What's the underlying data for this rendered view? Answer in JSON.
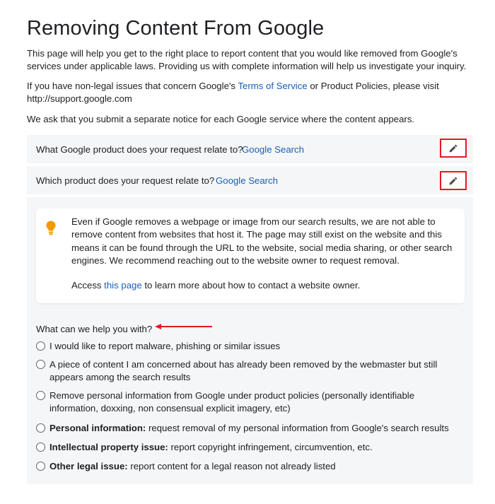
{
  "page": {
    "title": "Removing Content From Google",
    "intro": "This page will help you get to the right place to report content that you would like removed from Google's services under applicable laws. Providing us with complete information will help us investigate your inquiry.",
    "nonlegal_pre": "If you have non-legal issues that concern Google's ",
    "terms_link": "Terms of Service",
    "nonlegal_post": " or Product Policies, please visit http://support.google.com",
    "separate_notice": "We ask that you submit a separate notice for each Google service where the content appears."
  },
  "questions": [
    {
      "question": "What Google product does your request relate to?",
      "answer": "Google Search",
      "edit_icon": "pencil-icon"
    },
    {
      "question": "Which product does your request relate to?",
      "answer": "Google Search",
      "edit_icon": "pencil-icon"
    }
  ],
  "notice": {
    "icon": "lightbulb-icon",
    "text": "Even if Google removes a webpage or image from our search results, we are not able to remove content from websites that host it. The page may still exist on the website and this means it can be found through the URL to the website, social media sharing, or other search engines. We recommend reaching out to the website owner to request removal.",
    "access_pre": "Access ",
    "access_link": "this page",
    "access_post": " to learn more about how to contact a website owner."
  },
  "help": {
    "question": "What can we help you with?",
    "options": [
      {
        "bold": "",
        "text": "I would like to report malware, phishing or similar issues"
      },
      {
        "bold": "",
        "text": "A piece of content I am concerned about has already been removed by the webmaster but still appears among the search results"
      },
      {
        "bold": "",
        "text": "Remove personal information from Google under product policies (personally identifiable information, doxxing, non consensual explicit imagery, etc)"
      },
      {
        "bold": "Personal information:",
        "text": " request removal of my personal information from Google's search results"
      },
      {
        "bold": "Intellectual property issue:",
        "text": " report copyright infringement, circumvention, etc."
      },
      {
        "bold": "Other legal issue:",
        "text": " report content for a legal reason not already listed"
      }
    ]
  },
  "colors": {
    "accent_link": "#1a5fb4",
    "annotation_red": "#e01b24",
    "bulb": "#f29900",
    "panel_bg": "#f5f6f7"
  }
}
